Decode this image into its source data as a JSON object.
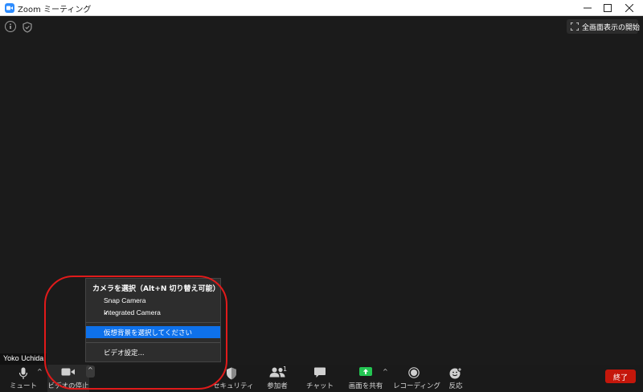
{
  "window": {
    "title": "Zoom ミーティング",
    "minimize": "minimize",
    "maximize": "maximize",
    "close": "close"
  },
  "top": {
    "fullscreen_label": "全画面表示の開始"
  },
  "participant_name": "Yoko Uchida",
  "camera_menu": {
    "header": "カメラを選択（Alt+N 切り替え可能）",
    "items": [
      {
        "label": "Snap Camera",
        "checked": false
      },
      {
        "label": "Integrated Camera",
        "checked": true
      }
    ],
    "checkmark": "✓",
    "virtual_background": "仮想背景を選択してください",
    "video_settings": "ビデオ設定..."
  },
  "toolbar": {
    "mute": "ミュート",
    "stop_video": "ビデオの停止",
    "security": "セキュリティ",
    "participants": "参加者",
    "participant_count": "1",
    "chat": "チャット",
    "share_screen": "画面を共有",
    "record": "レコーディング",
    "reactions": "反応",
    "end": "終了"
  },
  "colors": {
    "background": "#1b1b1b",
    "share_green": "#23c552",
    "end_red": "#c5170b",
    "highlight_blue": "#0e71eb",
    "annotation_red": "#e11a1a"
  }
}
